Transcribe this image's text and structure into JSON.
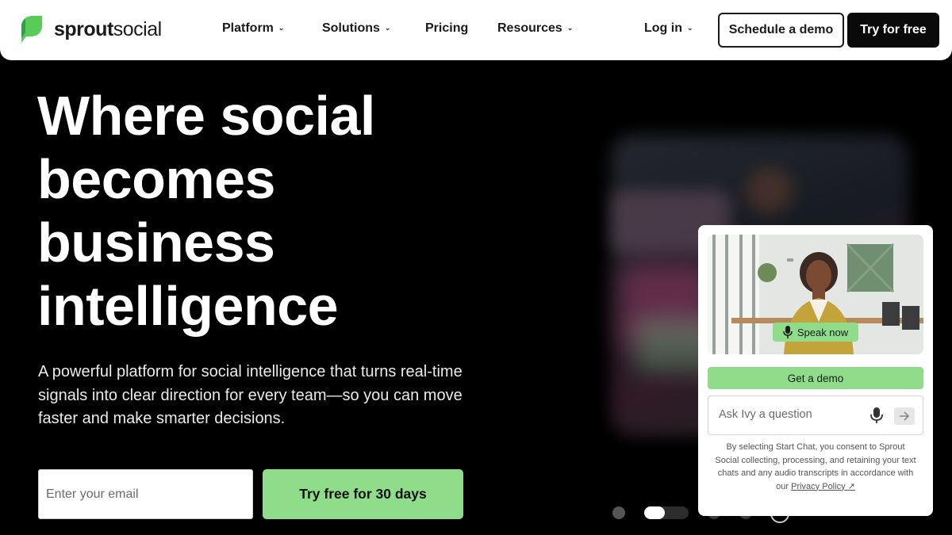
{
  "brand": {
    "name_bold": "sprout",
    "name_regular": "social",
    "logo_icon": "sprout-leaf-icon",
    "accent": "#8fdc8a",
    "logo_green": "#59cb59"
  },
  "nav": {
    "items": [
      {
        "label": "Platform",
        "has_dropdown": true
      },
      {
        "label": "Solutions",
        "has_dropdown": true
      },
      {
        "label": "Pricing",
        "has_dropdown": false
      },
      {
        "label": "Resources",
        "has_dropdown": true
      }
    ],
    "login": {
      "label": "Log in",
      "has_dropdown": true
    },
    "schedule_demo": "Schedule a demo",
    "try_free": "Try for free"
  },
  "hero": {
    "title_lines": [
      "Where social",
      "becomes",
      "business",
      "intelligence"
    ],
    "subtitle": "A powerful platform for social intelligence that turns real-time signals into clear direction for every team—so you can move faster and make smarter decisions.",
    "email_placeholder": "Enter your email",
    "cta_label": "Try free for 30 days"
  },
  "carousel": {
    "slide_count": 5,
    "active_index": 1,
    "pause_icon": "pause-icon"
  },
  "chat": {
    "speak_now": "Speak now",
    "get_demo": "Get a demo",
    "ask_placeholder": "Ask Ivy a question",
    "consent_text": "By selecting Start Chat, you consent to Sprout Social collecting, processing, and retaining your text chats and any audio transcripts in accordance with our",
    "privacy_link": "Privacy Policy"
  }
}
